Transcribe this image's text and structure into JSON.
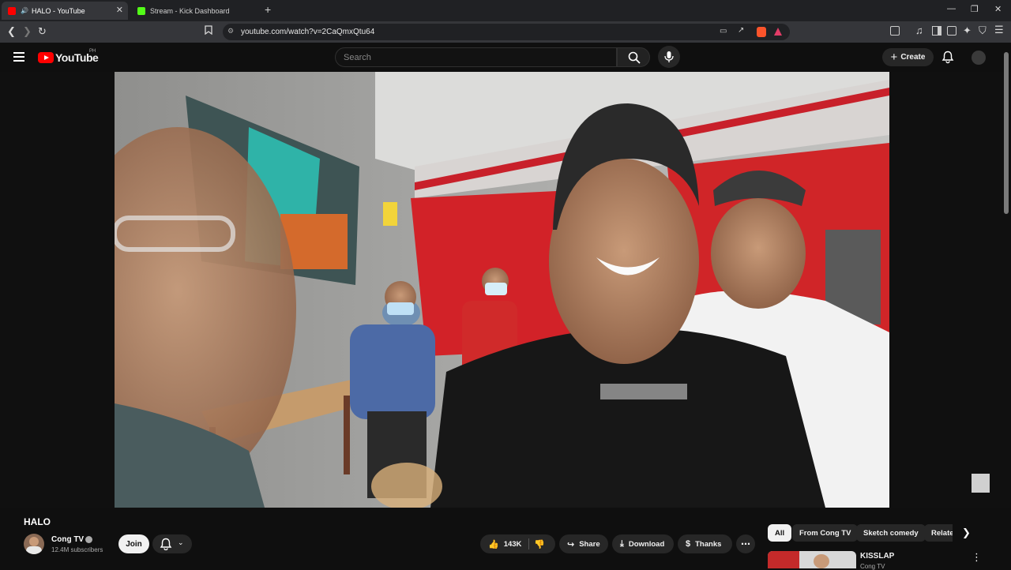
{
  "browser": {
    "tabs": [
      {
        "label": "HALO - YouTube",
        "active": true,
        "favicon_color": "#ff0000"
      },
      {
        "label": "Stream - Kick Dashboard",
        "active": false,
        "favicon_color": "#53fc18"
      }
    ],
    "url": "youtube.com/watch?v=2CaQmxQtu64"
  },
  "youtube": {
    "logo_text": "YouTube",
    "country_code": "PH",
    "search_placeholder": "Search",
    "create_label": "Create"
  },
  "video": {
    "title": "HALO",
    "channel": "Cong TV",
    "subscribers": "12.4M subscribers",
    "join_label": "Join",
    "likes": "143K",
    "share_label": "Share",
    "download_label": "Download",
    "thanks_label": "Thanks"
  },
  "sidebar": {
    "chips": [
      "All",
      "From Cong TV",
      "Sketch comedy",
      "Relate"
    ],
    "recommendation": {
      "title": "KISSLAP",
      "channel": "Cong TV"
    }
  }
}
